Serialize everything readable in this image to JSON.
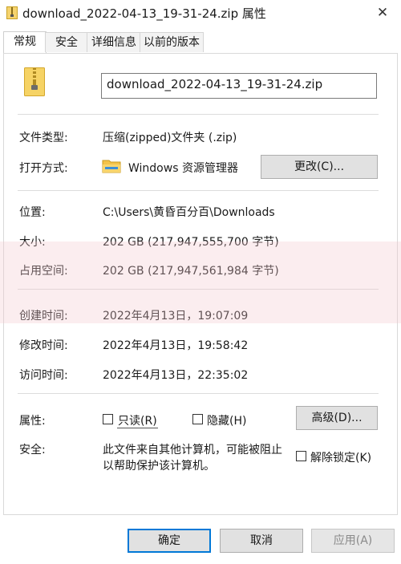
{
  "window": {
    "title": "download_2022-04-13_19-31-24.zip 属性",
    "close_glyph": "✕"
  },
  "tabs": [
    {
      "label": "常规",
      "active": true
    },
    {
      "label": "安全",
      "active": false
    },
    {
      "label": "详细信息",
      "active": false
    },
    {
      "label": "以前的版本",
      "active": false
    }
  ],
  "file": {
    "name": "download_2022-04-13_19-31-24.zip"
  },
  "props": {
    "type_label": "文件类型:",
    "type_value": "压缩(zipped)文件夹 (.zip)",
    "open_label": "打开方式:",
    "open_value": "Windows 资源管理器",
    "change_button": "更改(C)...",
    "location_label": "位置:",
    "location_value": "C:\\Users\\黄昏百分百\\Downloads",
    "size_label": "大小:",
    "size_value": "202 GB (217,947,555,700 字节)",
    "disk_label": "占用空间:",
    "disk_value": "202 GB (217,947,561,984 字节)",
    "created_label": "创建时间:",
    "created_value": "2022年4月13日，19:07:09",
    "modified_label": "修改时间:",
    "modified_value": "2022年4月13日，19:58:42",
    "accessed_label": "访问时间:",
    "accessed_value": "2022年4月13日，22:35:02",
    "attr_label": "属性:",
    "readonly_label": "只读(R)",
    "hidden_label": "隐藏(H)",
    "advanced_button": "高级(D)...",
    "security_label": "安全:",
    "security_text_line1": "此文件来自其他计算机，可能被阻止",
    "security_text_line2": "以帮助保护该计算机。",
    "unblock_label": "解除锁定(K)"
  },
  "footer": {
    "ok": "确定",
    "cancel": "取消",
    "apply": "应用(A)"
  },
  "colors": {
    "accent": "#0078d7",
    "folder_yellow": "#f2c94c",
    "overlay_pink": "#f4c8cd"
  }
}
